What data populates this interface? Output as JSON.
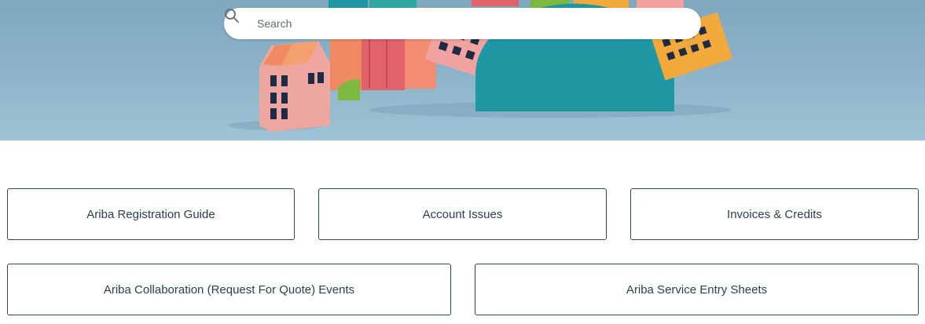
{
  "search": {
    "placeholder": "Search",
    "icon": "search-icon"
  },
  "hero": {
    "illustration": "paper-houses-illustration",
    "colors": {
      "sky": "#8db4c9",
      "teal": "#1f98a4",
      "pink": "#eea6a0",
      "red": "#e2626a",
      "orange": "#f08a63",
      "yellow": "#f2a93b",
      "green": "#7cb93f"
    }
  },
  "categories": [
    {
      "label": "Ariba Registration Guide"
    },
    {
      "label": "Account Issues"
    },
    {
      "label": "Invoices & Credits"
    },
    {
      "label": "Ariba Collaboration (Request For Quote) Events"
    },
    {
      "label": "Ariba Service Entry Sheets"
    }
  ],
  "colors": {
    "card_border": "#274a5c",
    "card_text": "#2b3f4c"
  }
}
